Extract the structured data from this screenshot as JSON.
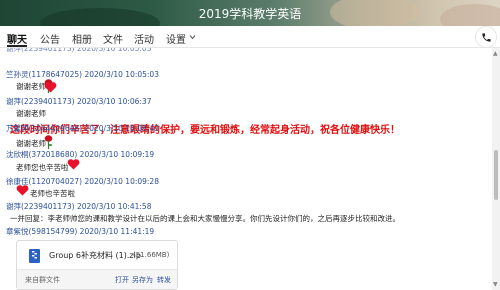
{
  "window": {
    "title": "2019学科教学英语"
  },
  "tabs": [
    {
      "label": "聊天",
      "active": true
    },
    {
      "label": "公告"
    },
    {
      "label": "相册"
    },
    {
      "label": "文件"
    },
    {
      "label": "活动"
    },
    {
      "label": "设置"
    }
  ],
  "header_icons": {
    "settings_chevron": "chevron-down-icon",
    "phone": "phone-icon"
  },
  "messages": [
    {
      "meta": "竺孙灵(1178647025) 2020/3/10 10:05:03",
      "text": "谢谢老师"
    },
    {
      "meta": "谢萍(2239401173) 2020/3/10 10:06:37",
      "text": "谢谢老师"
    },
    {
      "text": "这段时间你们辛苦了，注意眼睛的保护，要远和锻炼，经常起身活动，祝各位健康快乐！"
    },
    {
      "meta": "万馨萍(1044429646) 2020/3/10 10:08:43",
      "text": "谢谢老师"
    },
    {
      "meta": "沈欣桐(372018680) 2020/3/10 10:09:19",
      "text": "老师您也辛苦啦"
    },
    {
      "meta": "徐康佳(1120704027) 2020/3/10 10:09:28",
      "text": "老师也辛苦啦"
    },
    {
      "meta": "谢萍(2239401173) 2020/3/10 10:41:58",
      "text": "一并回复：李老师帅您的课和教学设计在以后的课上会和大家慢慢分享。你们先设计你们的，之后再逐步比较和改进。"
    },
    {
      "meta": "章紫悦(598154799) 2020/3/10 11:41:19"
    }
  ],
  "file": {
    "name": "Group 6补充材料 (1).zip",
    "size": "(51.66MB)",
    "source": "来自群文件",
    "actions": [
      "打开",
      "另存为",
      "转发"
    ]
  },
  "colors": {
    "meta": "#2a4f9e",
    "red_message": "#e01010",
    "heart": "#e8102a",
    "file_icon": "#2b63c4"
  }
}
